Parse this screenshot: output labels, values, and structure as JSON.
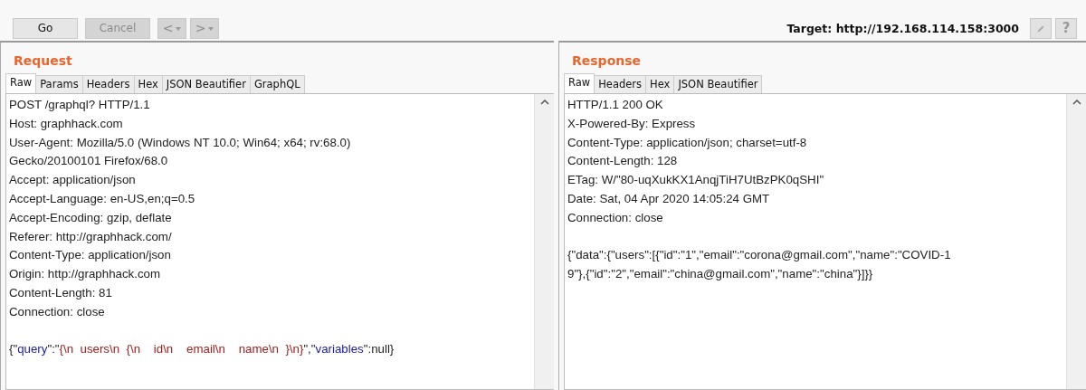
{
  "toolbar": {
    "buttons": [
      {
        "label": "Go",
        "disabled": false
      },
      {
        "label": "Cancel",
        "disabled": true
      }
    ],
    "nav": [
      {
        "label": "<",
        "disabled": true
      },
      {
        "label": ">",
        "disabled": true
      }
    ],
    "target": "Target: http://192.168.114.158:3000",
    "help": "?"
  },
  "panels": [
    {
      "title": "Request",
      "tabs": [
        {
          "label": "Raw",
          "selected": true
        },
        {
          "label": "Params",
          "selected": false
        },
        {
          "label": "Headers",
          "selected": false
        },
        {
          "label": "Hex",
          "selected": false
        },
        {
          "label": "JSON Beautifier",
          "selected": false
        },
        {
          "label": "GraphQL",
          "selected": false
        }
      ],
      "lines": [
        "POST /graphql? HTTP/1.1",
        "Host: graphhack.com",
        "User-Agent: Mozilla/5.0 (Windows NT 10.0; Win64; x64; rv:68.0)",
        "Gecko/20100101 Firefox/68.0",
        "Accept: application/json",
        "Accept-Language: en-US,en;q=0.5",
        "Accept-Encoding: gzip, deflate",
        "Referer: http://graphhack.com/",
        "Content-Type: application/json",
        "Origin: http://graphhack.com",
        "Content-Length: 81",
        "Connection: close"
      ],
      "body": [
        [
          {
            "kind": "punct",
            "text": "{\""
          },
          {
            "kind": "key",
            "text": "query"
          },
          {
            "kind": "punct",
            "text": "\":\""
          },
          {
            "kind": "string",
            "text": "{\\n  users\\n  {\\n    id\\n    email\\n    name\\n  }\\n}"
          },
          {
            "kind": "punct",
            "text": "\",\""
          },
          {
            "kind": "key",
            "text": "variables"
          },
          {
            "kind": "punct",
            "text": "\":null}"
          }
        ]
      ]
    },
    {
      "title": "Response",
      "tabs": [
        {
          "label": "Raw",
          "selected": true
        },
        {
          "label": "Headers",
          "selected": false
        },
        {
          "label": "Hex",
          "selected": false
        },
        {
          "label": "JSON Beautifier",
          "selected": false
        }
      ],
      "lines": [
        "HTTP/1.1 200 OK",
        "X-Powered-By: Express",
        "Content-Type: application/json; charset=utf-8",
        "Content-Length: 128",
        "ETag: W/\"80-uqXukKX1AnqjTiH7UtBzPK0qSHI\"",
        "Date: Sat, 04 Apr 2020 14:05:24 GMT",
        "Connection: close"
      ],
      "body": [
        [
          {
            "kind": "punct",
            "text": "{\"data\":{\"users\":[{\"id\":\"1\",\"email\":\"corona@gmail.com\",\"name\":\"COVID-1"
          }
        ],
        [
          {
            "kind": "punct",
            "text": "9\"},{\"id\":\"2\",\"email\":\"china@gmail.com\",\"name\":\"china\"}]}}"
          }
        ]
      ]
    }
  ]
}
